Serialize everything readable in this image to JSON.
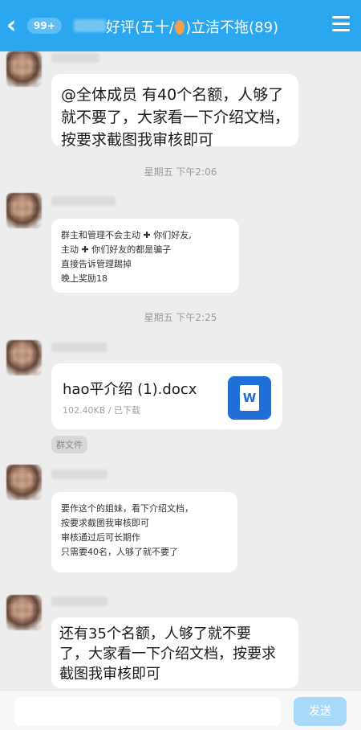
{
  "header": {
    "back_badge": "99+",
    "title_prefix": "好评(五十/",
    "title_suffix": ")立洁不拖(89)"
  },
  "messages": [
    {
      "lines": [
        "@全体成员 有40个名额，人够了",
        "就不要了，大家看一下介绍文档，",
        "按要求截图我审核即可"
      ]
    },
    {
      "lines": [
        "群主和管理不会主动 ✚ 你们好友,",
        "主动 ✚ 你们好友的都是骗子",
        "直接告诉管理踢掉",
        "晚上奖励18"
      ]
    },
    {
      "file_name": "hao平介绍 (1).docx",
      "file_meta": "102.40KB / 已下载",
      "file_icon_letter": "W"
    },
    {
      "lines": [
        "要作这个的姐妹，看下介绍文档，",
        "按要求截图我审核即可",
        "审核通过后可长期作",
        "只需要40名，人够了就不要了"
      ]
    },
    {
      "lines": [
        "还有35个名额，人够了就不要",
        "了，大家看一下介绍文档，按要求",
        "截图我审核即可"
      ]
    }
  ],
  "timestamps": [
    "星期五 下午2:06",
    "星期五 下午2:25"
  ],
  "file_tag": "群文件",
  "input": {
    "send_label": "发送"
  },
  "icons": {
    "back": "chevron-left-icon",
    "menu": "hamburger-menu-icon",
    "file": "word-doc-icon"
  },
  "colors": {
    "header_bg": "#2aa7ef",
    "send_button": "#a9d9f8",
    "word_icon": "#1f6fd6"
  }
}
